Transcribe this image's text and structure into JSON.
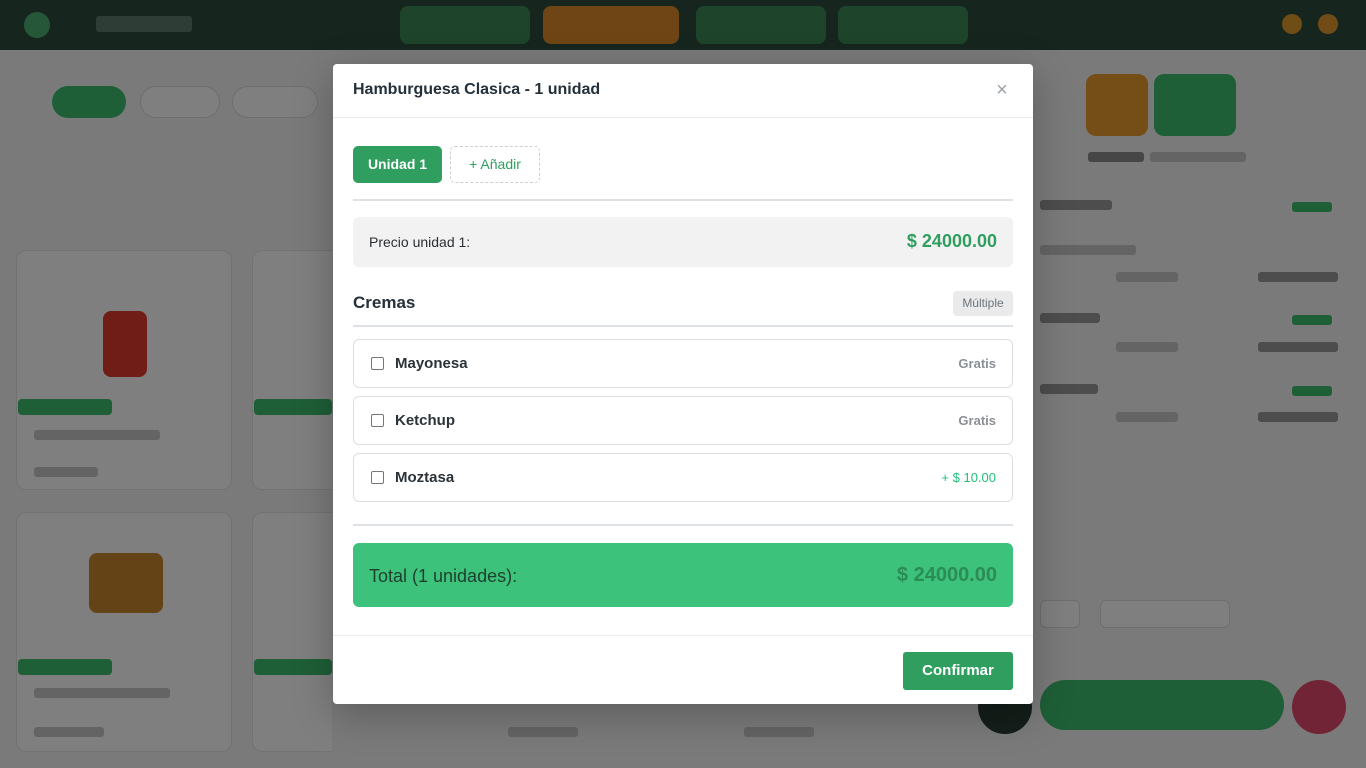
{
  "modal": {
    "title": "Hamburguesa Clasica - 1 unidad",
    "close_symbol": "×",
    "tabs": [
      {
        "label": "Unidad 1",
        "active": true
      }
    ],
    "add_tab_label": "+ Añadir",
    "unit_price": {
      "label": "Precio unidad 1:",
      "value": "$ 24000.00"
    },
    "section": {
      "title": "Cremas",
      "badge": "Múltiple",
      "options": [
        {
          "name": "Mayonesa",
          "price": "Gratis",
          "checked": false
        },
        {
          "name": "Ketchup",
          "price": "Gratis",
          "checked": false
        },
        {
          "name": "Moztasa",
          "price": "+ $ 10.00",
          "checked": false
        }
      ]
    },
    "total": {
      "label": "Total (1 unidades):",
      "value": "$ 24000.00"
    },
    "confirm_label": "Confirmar"
  },
  "colors": {
    "primary": "#2f9e5f",
    "total_bg": "#3dc27b",
    "extra_price": "#20c07a",
    "topbar": "#2f4a3f"
  },
  "icons": {
    "close": "close-icon",
    "checkbox": "checkbox-icon"
  }
}
